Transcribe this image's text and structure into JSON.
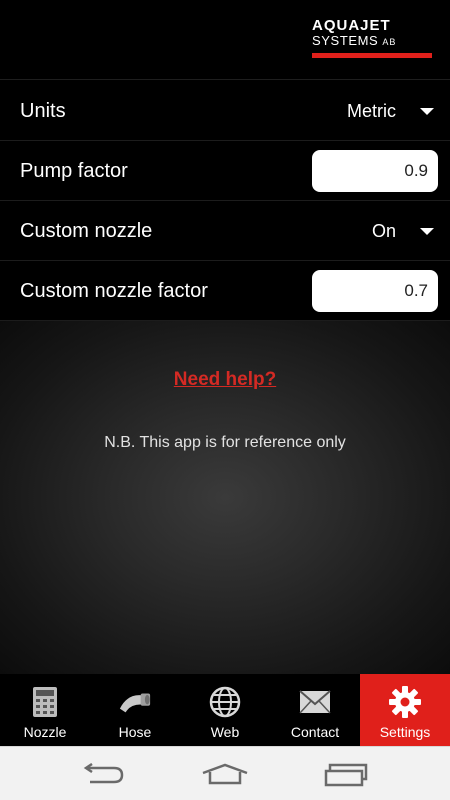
{
  "header": {
    "logo_line1": "AQUAJET",
    "logo_line2": "SYSTEMS",
    "logo_ab": "AB"
  },
  "settings": [
    {
      "label": "Units",
      "type": "dropdown",
      "value": "Metric"
    },
    {
      "label": "Pump factor",
      "type": "input",
      "value": "0.9"
    },
    {
      "label": "Custom nozzle",
      "type": "dropdown",
      "value": "On"
    },
    {
      "label": "Custom nozzle factor",
      "type": "input",
      "value": "0.7"
    }
  ],
  "content": {
    "help_link": "Need help?",
    "note": "N.B. This app is for reference only"
  },
  "tabs": [
    {
      "label": "Nozzle",
      "icon": "calculator-icon",
      "active": false
    },
    {
      "label": "Hose",
      "icon": "hose-icon",
      "active": false
    },
    {
      "label": "Web",
      "icon": "globe-icon",
      "active": false
    },
    {
      "label": "Contact",
      "icon": "envelope-icon",
      "active": false
    },
    {
      "label": "Settings",
      "icon": "gear-icon",
      "active": true
    }
  ],
  "colors": {
    "accent": "#e0201b",
    "link": "#d42a24",
    "background": "#000000",
    "navbar": "#f2f2f2"
  }
}
